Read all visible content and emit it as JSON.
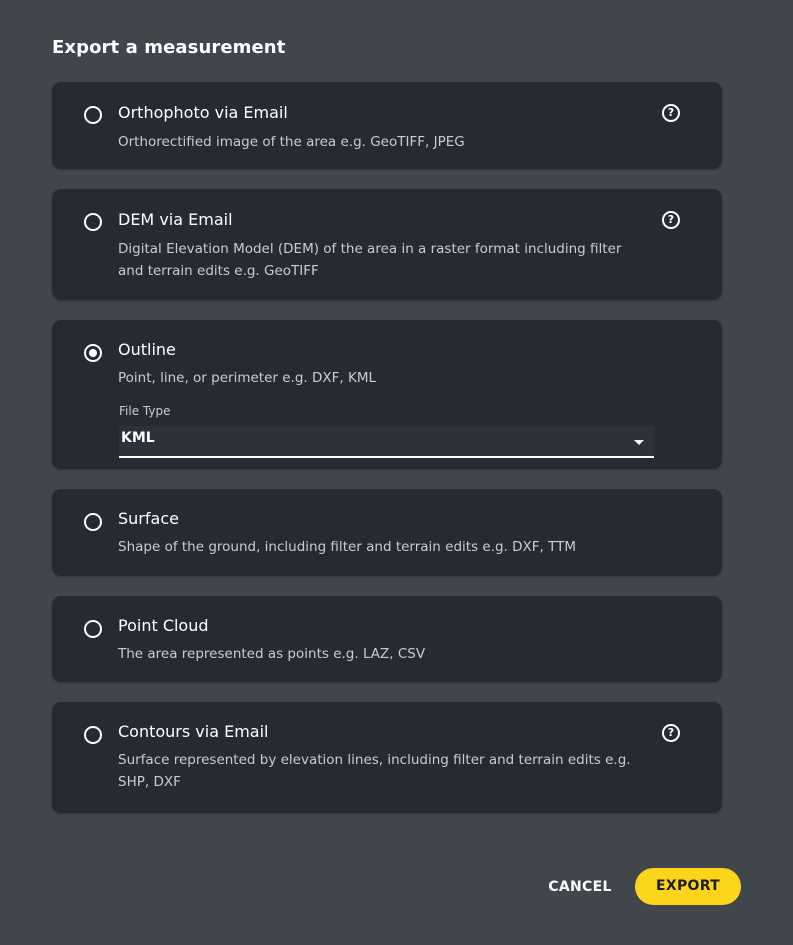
{
  "dialog": {
    "title": "Export a measurement"
  },
  "options": [
    {
      "title": "Orthophoto via Email",
      "description": "Orthorectified image of the area e.g. GeoTIFF, JPEG",
      "selected": false,
      "has_help": true,
      "help_icon": "help-circle-icon"
    },
    {
      "title": "DEM via Email",
      "description": "Digital Elevation Model (DEM) of the area in a raster format including filter and terrain edits e.g. GeoTIFF",
      "selected": false,
      "has_help": true,
      "help_icon": "help-circle-icon"
    },
    {
      "title": "Outline",
      "description": "Point, line, or perimeter e.g. DXF, KML",
      "selected": true,
      "has_help": false,
      "file_type": {
        "label": "File Type",
        "value": "KML"
      }
    },
    {
      "title": "Surface",
      "description": "Shape of the ground, including filter and terrain edits e.g. DXF, TTM",
      "selected": false,
      "has_help": false
    },
    {
      "title": "Point Cloud",
      "description": "The area represented as points e.g. LAZ, CSV",
      "selected": false,
      "has_help": false
    },
    {
      "title": "Contours via Email",
      "description": "Surface represented by elevation lines, including filter and terrain edits e.g. SHP, DXF",
      "selected": false,
      "has_help": true,
      "help_icon": "help-circle-icon"
    }
  ],
  "actions": {
    "cancel_label": "CANCEL",
    "export_label": "EXPORT"
  },
  "colors": {
    "background": "#41464d",
    "card": "#262b33",
    "accent": "#fcd41a",
    "muted_text": "#c9ccd0"
  }
}
